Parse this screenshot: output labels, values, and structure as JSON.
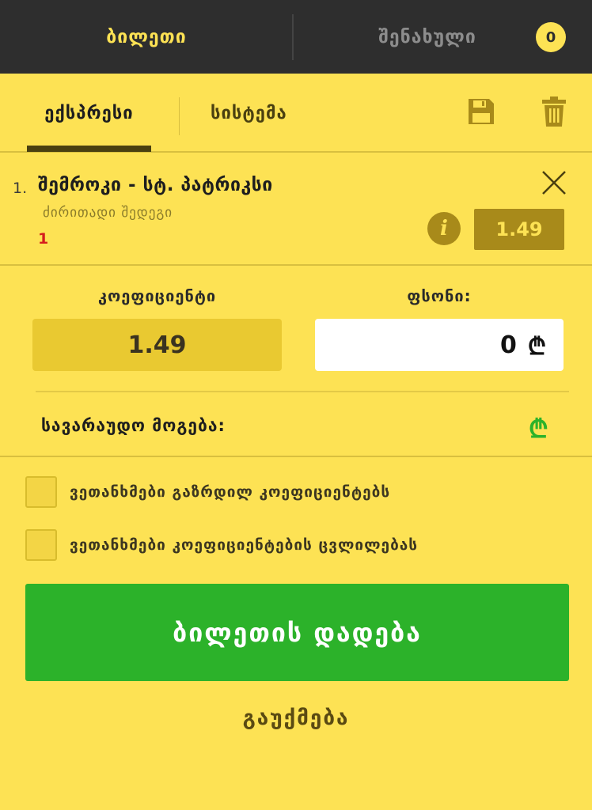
{
  "header": {
    "ticket_tab": "ბილეთი",
    "saved_tab": "შენახული",
    "saved_count": "0"
  },
  "modes": {
    "express": "ექსპრესი",
    "system": "სისტემა",
    "save_icon": "floppy-disk-icon",
    "trash_icon": "trash-icon"
  },
  "bet": {
    "index": "1.",
    "title": "შემროკი - სტ. პატრიკსი",
    "market": "ძირითადი შედეგი",
    "outcome": "1",
    "odd": "1.49"
  },
  "coef": {
    "label": "კოეფიციენტი",
    "value": "1.49"
  },
  "stake": {
    "label": "ფსონი:",
    "value": "0",
    "currency": "₾"
  },
  "potential": {
    "label": "სავარაუდო მოგება:",
    "currency": "₾"
  },
  "options": {
    "accept_increased": "ვეთანხმები გაზრდილ კოეფიციენტებს",
    "accept_changes": "ვეთანხმები კოეფიციენტების ცვლილებას"
  },
  "actions": {
    "place": "ბილეთის დადება",
    "cancel": "გაუქმება"
  },
  "colors": {
    "background": "#fde254",
    "topbar": "#2e2e2e",
    "accent_dark": "#a88a1a",
    "success": "#2cb22a",
    "outcome": "#d51d1d"
  }
}
